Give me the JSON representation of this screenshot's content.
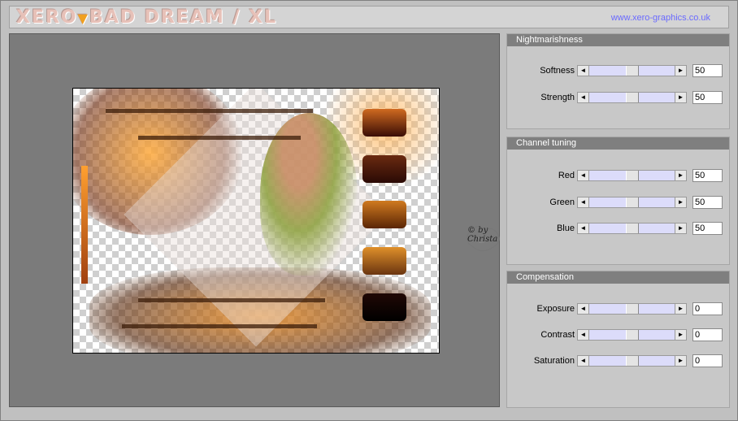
{
  "header": {
    "logo_left": "XERO",
    "logo_sep": "▼",
    "logo_right": "BAD DREAM / XL",
    "url": "www.xero-graphics.co.uk"
  },
  "preview": {
    "watermark_text": "© by Christa"
  },
  "panels": [
    {
      "title": "Nightmarishness",
      "controls": [
        {
          "label": "Softness",
          "value": "50",
          "level": 0.5
        },
        {
          "label": "Strength",
          "value": "50",
          "level": 0.5
        }
      ]
    },
    {
      "title": "Channel tuning",
      "controls": [
        {
          "label": "Red",
          "value": "50",
          "level": 0.5
        },
        {
          "label": "Green",
          "value": "50",
          "level": 0.5
        },
        {
          "label": "Blue",
          "value": "50",
          "level": 0.5
        }
      ]
    },
    {
      "title": "Compensation",
      "controls": [
        {
          "label": "Exposure",
          "value": "0",
          "level": 0.5
        },
        {
          "label": "Contrast",
          "value": "0",
          "level": 0.5
        },
        {
          "label": "Saturation",
          "value": "0",
          "level": 0.5
        }
      ]
    }
  ],
  "icons": {
    "arrow_left": "◄",
    "arrow_right": "►"
  },
  "colors": {
    "url": "#6a6aff",
    "panel_header": "#7f7f7f",
    "slider_track": "#dcdcfa"
  }
}
